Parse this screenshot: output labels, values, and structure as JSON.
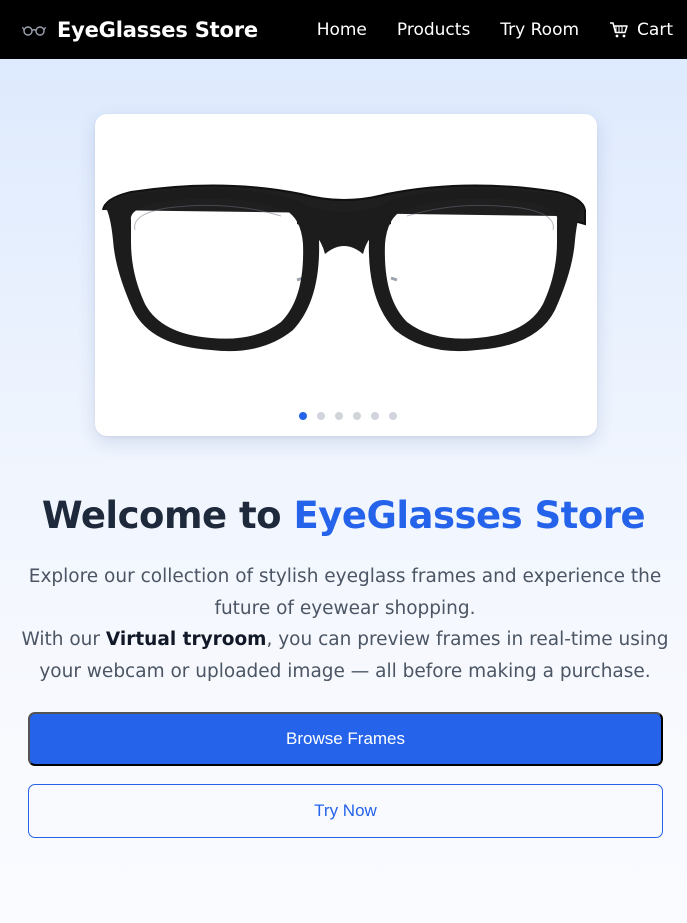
{
  "nav": {
    "brand": "EyeGlasses Store",
    "brand_icon": "eyeglasses-icon",
    "links": [
      {
        "label": "Home"
      },
      {
        "label": "Products"
      },
      {
        "label": "Try Room"
      },
      {
        "label": "Cart",
        "icon": "cart-icon"
      }
    ]
  },
  "carousel": {
    "slide_image": "eyeglasses-frame-black",
    "slide_count": 6,
    "active_index": 0
  },
  "hero": {
    "title_prefix": "Welcome to ",
    "title_accent": "EyeGlasses Store",
    "description_line1": "Explore our collection of stylish eyeglass frames and experience the future of eyewear shopping.",
    "description_line2_prefix": "With our ",
    "description_line2_bold": "Virtual tryroom",
    "description_line2_suffix": ", you can preview frames in real-time using your webcam or uploaded image — all before making a purchase."
  },
  "buttons": {
    "browse": "Browse Frames",
    "try_now": "Try Now"
  },
  "colors": {
    "accent": "#2563eb",
    "navbar": "#000000"
  }
}
